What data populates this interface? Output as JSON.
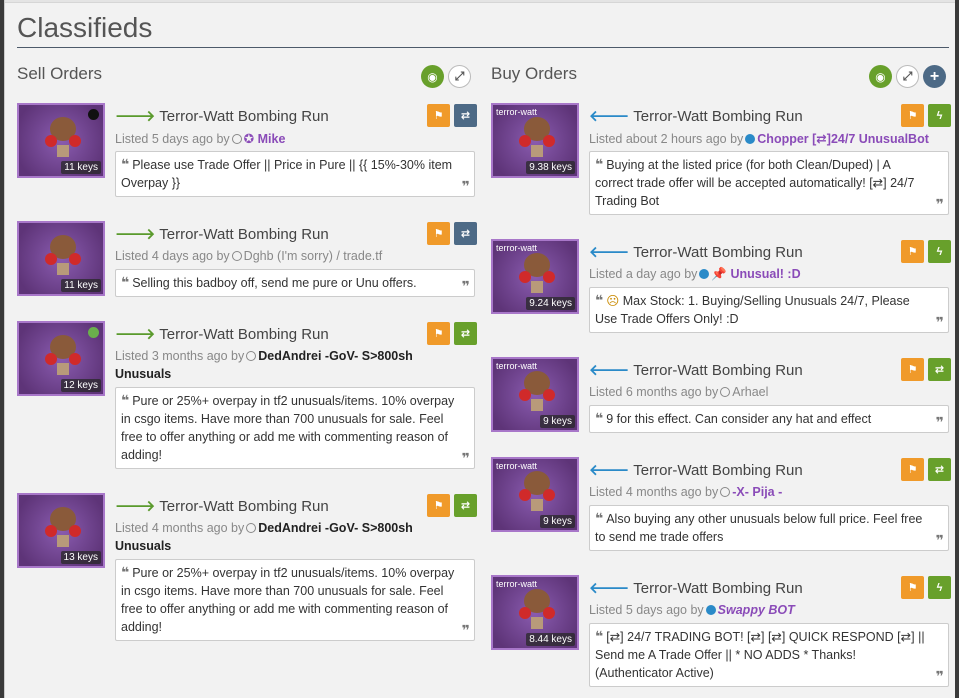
{
  "page": {
    "title": "Classifieds"
  },
  "sell": {
    "heading": "Sell Orders",
    "listings": [
      {
        "item": "Terror-Watt Bombing Run",
        "price": "11 keys",
        "listed": "Listed 5 days ago by",
        "user": "Mike",
        "user_extra": "",
        "message": "Please use Trade Offer || Price in Pure || {{ 15%-30% item Overpay }}"
      },
      {
        "item": "Terror-Watt Bombing Run",
        "price": "11 keys",
        "listed": "Listed 4 days ago by",
        "user": "Dghb (I'm sorry) / trade.tf",
        "user_extra": "",
        "message": "Selling this badboy off, send me pure or Unu offers."
      },
      {
        "item": "Terror-Watt Bombing Run",
        "price": "12 keys",
        "listed": "Listed 3 months ago by",
        "user": "DedAndrei -GoV- S>800sh",
        "user_extra": "Unusuals",
        "message": "Pure or 25%+ overpay in tf2 unusuals/items. 10% overpay in csgo items. Have more than 700 unusuals for sale. Feel free to offer anything or add me with commenting reason of adding!"
      },
      {
        "item": "Terror-Watt Bombing Run",
        "price": "13 keys",
        "listed": "Listed 4 months ago by",
        "user": "DedAndrei -GoV- S>800sh",
        "user_extra": "Unusuals",
        "message": "Pure or 25%+ overpay in tf2 unusuals/items. 10% overpay in csgo items. Have more than 700 unusuals for sale. Feel free to offer anything or add me with commenting reason of adding!"
      }
    ]
  },
  "buy": {
    "heading": "Buy Orders",
    "listings": [
      {
        "item": "Terror-Watt Bombing Run",
        "effect": "terror-watt",
        "price": "9.38 keys",
        "listed": "Listed about 2 hours ago by",
        "user": "Chopper [⇄]24/7 UnusualBot",
        "message": "Buying at the listed price (for both Clean/Duped) | A correct trade offer will be accepted automatically! [⇄] 24/7 Trading Bot"
      },
      {
        "item": "Terror-Watt Bombing Run",
        "effect": "terror-watt",
        "price": "9.24 keys",
        "listed": "Listed a day ago by",
        "user": "Unusual! :D",
        "message": "Max Stock: 1. Buying/Selling Unusuals 24/7, Please Use Trade Offers Only! :D"
      },
      {
        "item": "Terror-Watt Bombing Run",
        "effect": "terror-watt",
        "price": "9 keys",
        "listed": "Listed 6 months ago by",
        "user": "Arhael",
        "message": "9 for this effect. Can consider any hat and effect"
      },
      {
        "item": "Terror-Watt Bombing Run",
        "effect": "terror-watt",
        "price": "9 keys",
        "listed": "Listed 4 months ago by",
        "user": "-X- Pija -",
        "message": "Also buying any other unusuals below full price. Feel free to send me trade offers"
      },
      {
        "item": "Terror-Watt Bombing Run",
        "effect": "terror-watt",
        "price": "8.44 keys",
        "listed": "Listed 5 days ago by",
        "user": "Swappy BOT",
        "message": "[⇄] 24/7 TRADING BOT! [⇄] [⇄] QUICK RESPOND [⇄] || Send me A Trade Offer || * NO ADDS * Thanks! (Authenticator Active)"
      }
    ]
  },
  "colors": {
    "thumb_border": "#a877c9",
    "orange": "#f09a2a",
    "green": "#68a02b",
    "slate": "#4d6a86",
    "user_purple": "#8a4bb8"
  }
}
